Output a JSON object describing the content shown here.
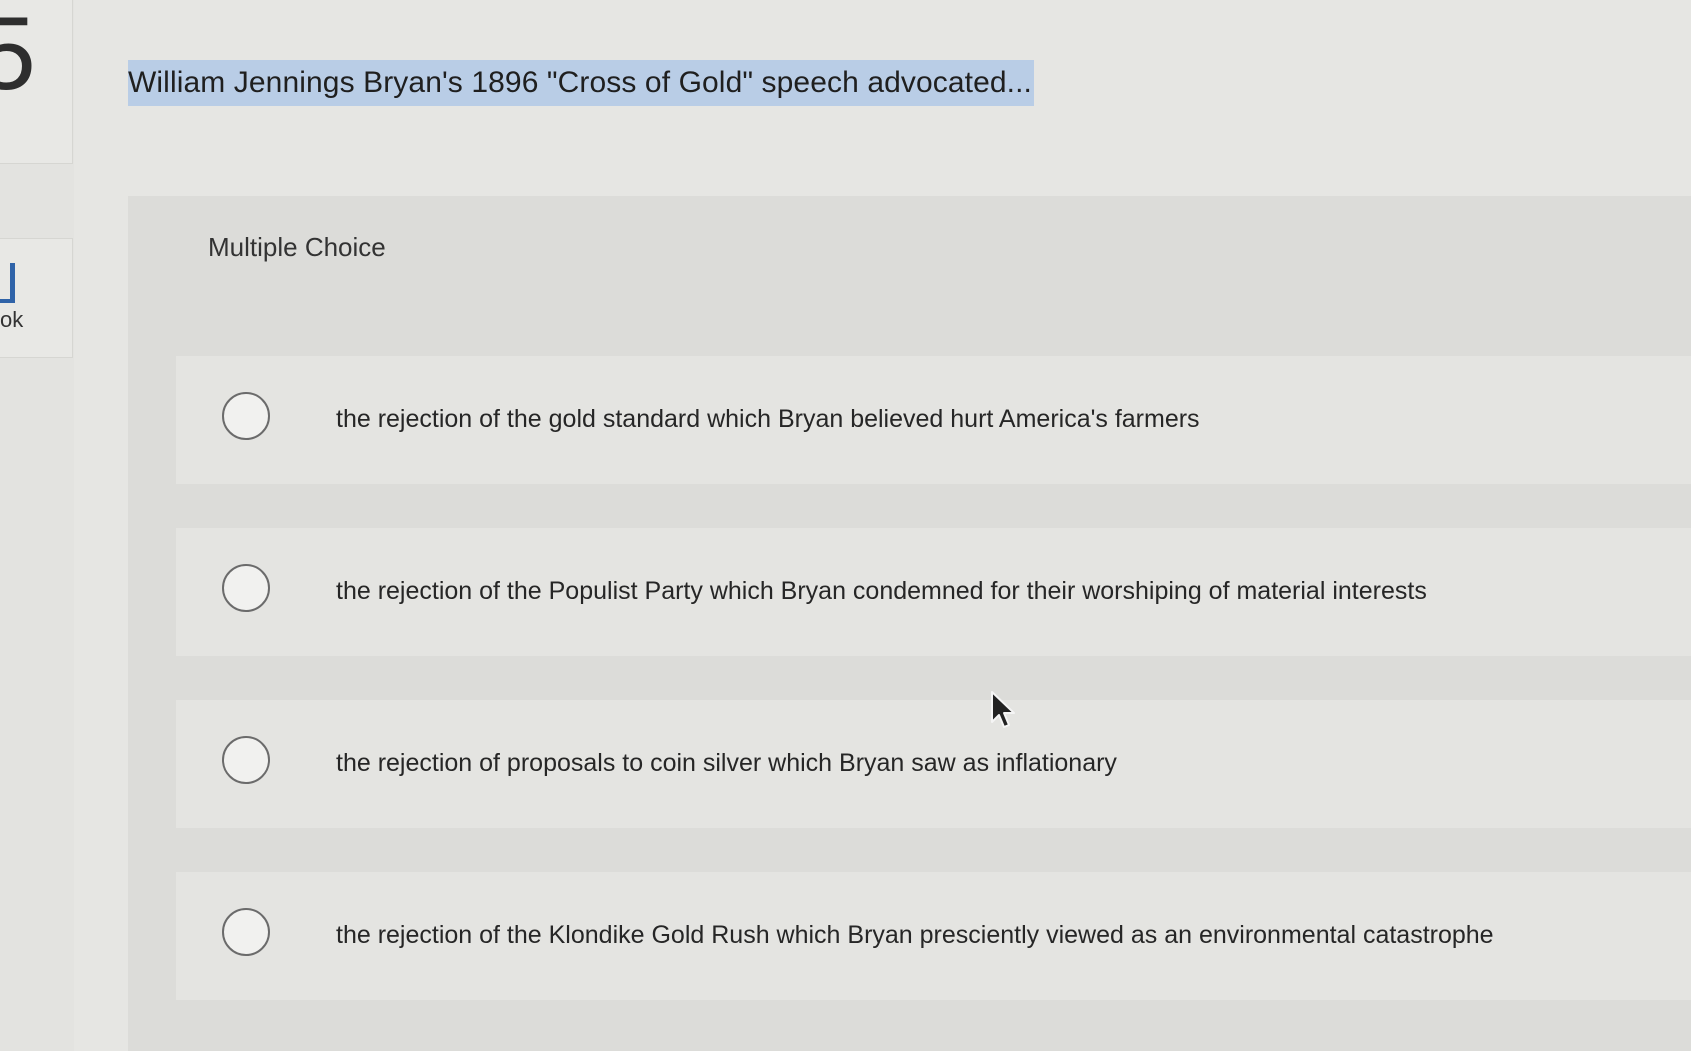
{
  "left_rail": {
    "question_number_fragment": "5",
    "ebook_label_fragment": "ok"
  },
  "question": {
    "text": "William Jennings Bryan's 1896 \"Cross of Gold\" speech advocated..."
  },
  "answer_panel": {
    "type_label": "Multiple Choice",
    "options": [
      {
        "text": "the rejection of the gold standard which Bryan believed hurt America's farmers",
        "selected": false
      },
      {
        "text": "the rejection of the Populist Party which Bryan condemned for their worshiping of material interests",
        "selected": false
      },
      {
        "text": "the rejection of proposals to coin silver which Bryan saw as inflationary",
        "selected": false
      },
      {
        "text": "the rejection of the Klondike Gold Rush which Bryan presciently viewed as an environmental catastrophe",
        "selected": false
      }
    ]
  },
  "icons": {
    "ebook": "book-icon",
    "radio": "radio-unchecked-icon",
    "cursor": "mouse-pointer-icon"
  },
  "colors": {
    "highlight": "#b9cde6",
    "ebook_accent": "#2f63a8"
  }
}
